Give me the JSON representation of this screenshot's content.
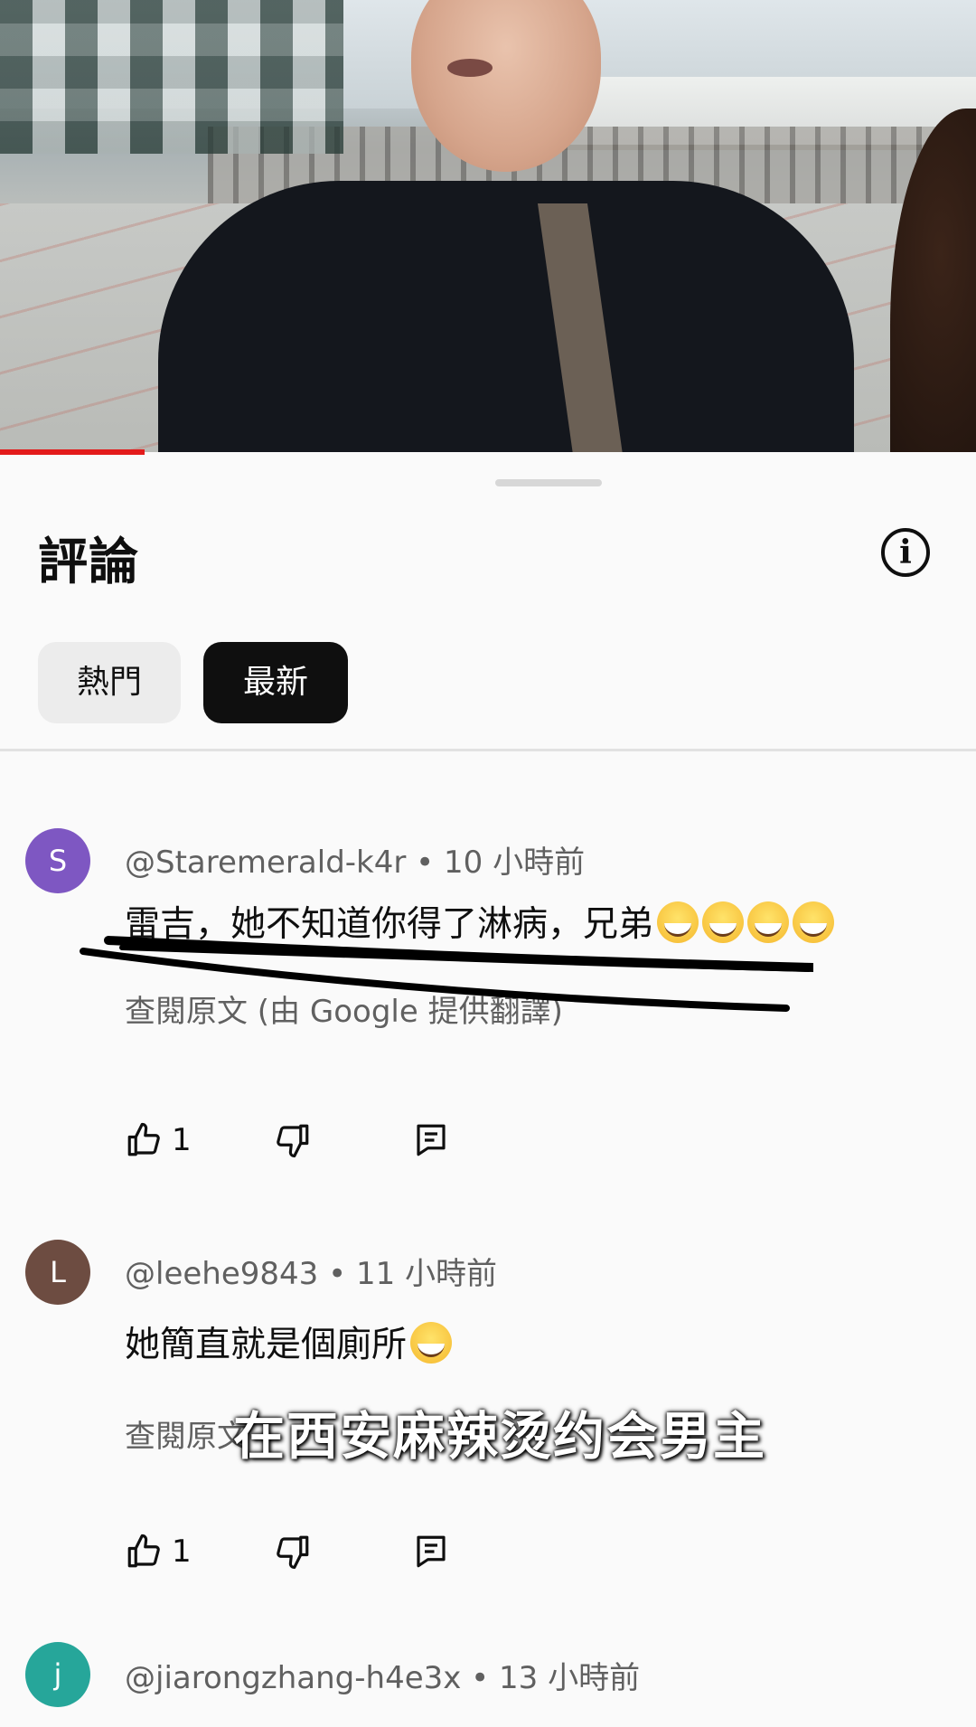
{
  "sheet": {
    "title": "評論",
    "filters": [
      {
        "label": "熱門",
        "selected": false
      },
      {
        "label": "最新",
        "selected": true
      }
    ]
  },
  "comments": [
    {
      "avatar_letter": "S",
      "avatar_color": "#7e57c2",
      "meta": "@Staremerald-k4r • 10 小時前",
      "text": "雷吉，她不知道你得了淋病，兄弟",
      "emoji_count": 4,
      "translate": "查閱原文 (由 Google 提供翻譯)",
      "likes": "1"
    },
    {
      "avatar_letter": "L",
      "avatar_color": "#6d4c41",
      "meta": "@leehe9843 • 11 小時前",
      "text": "她簡直就是個廁所",
      "emoji_count": 1,
      "translate": "查閱原文",
      "likes": "1"
    },
    {
      "avatar_letter": "j",
      "avatar_color": "#26a69a",
      "meta": "@jiarongzhang-h4e3x • 13 小時前"
    }
  ],
  "overlay_caption": "在西安麻辣烫约会男主",
  "colors": {
    "progress": "#e31b1b",
    "selected_chip": "#0f0f0f",
    "secondary_text": "#606060"
  },
  "icons": [
    "info-icon",
    "thumbs-up-icon",
    "thumbs-down-icon",
    "reply-icon",
    "laughing-emoji-icon"
  ]
}
